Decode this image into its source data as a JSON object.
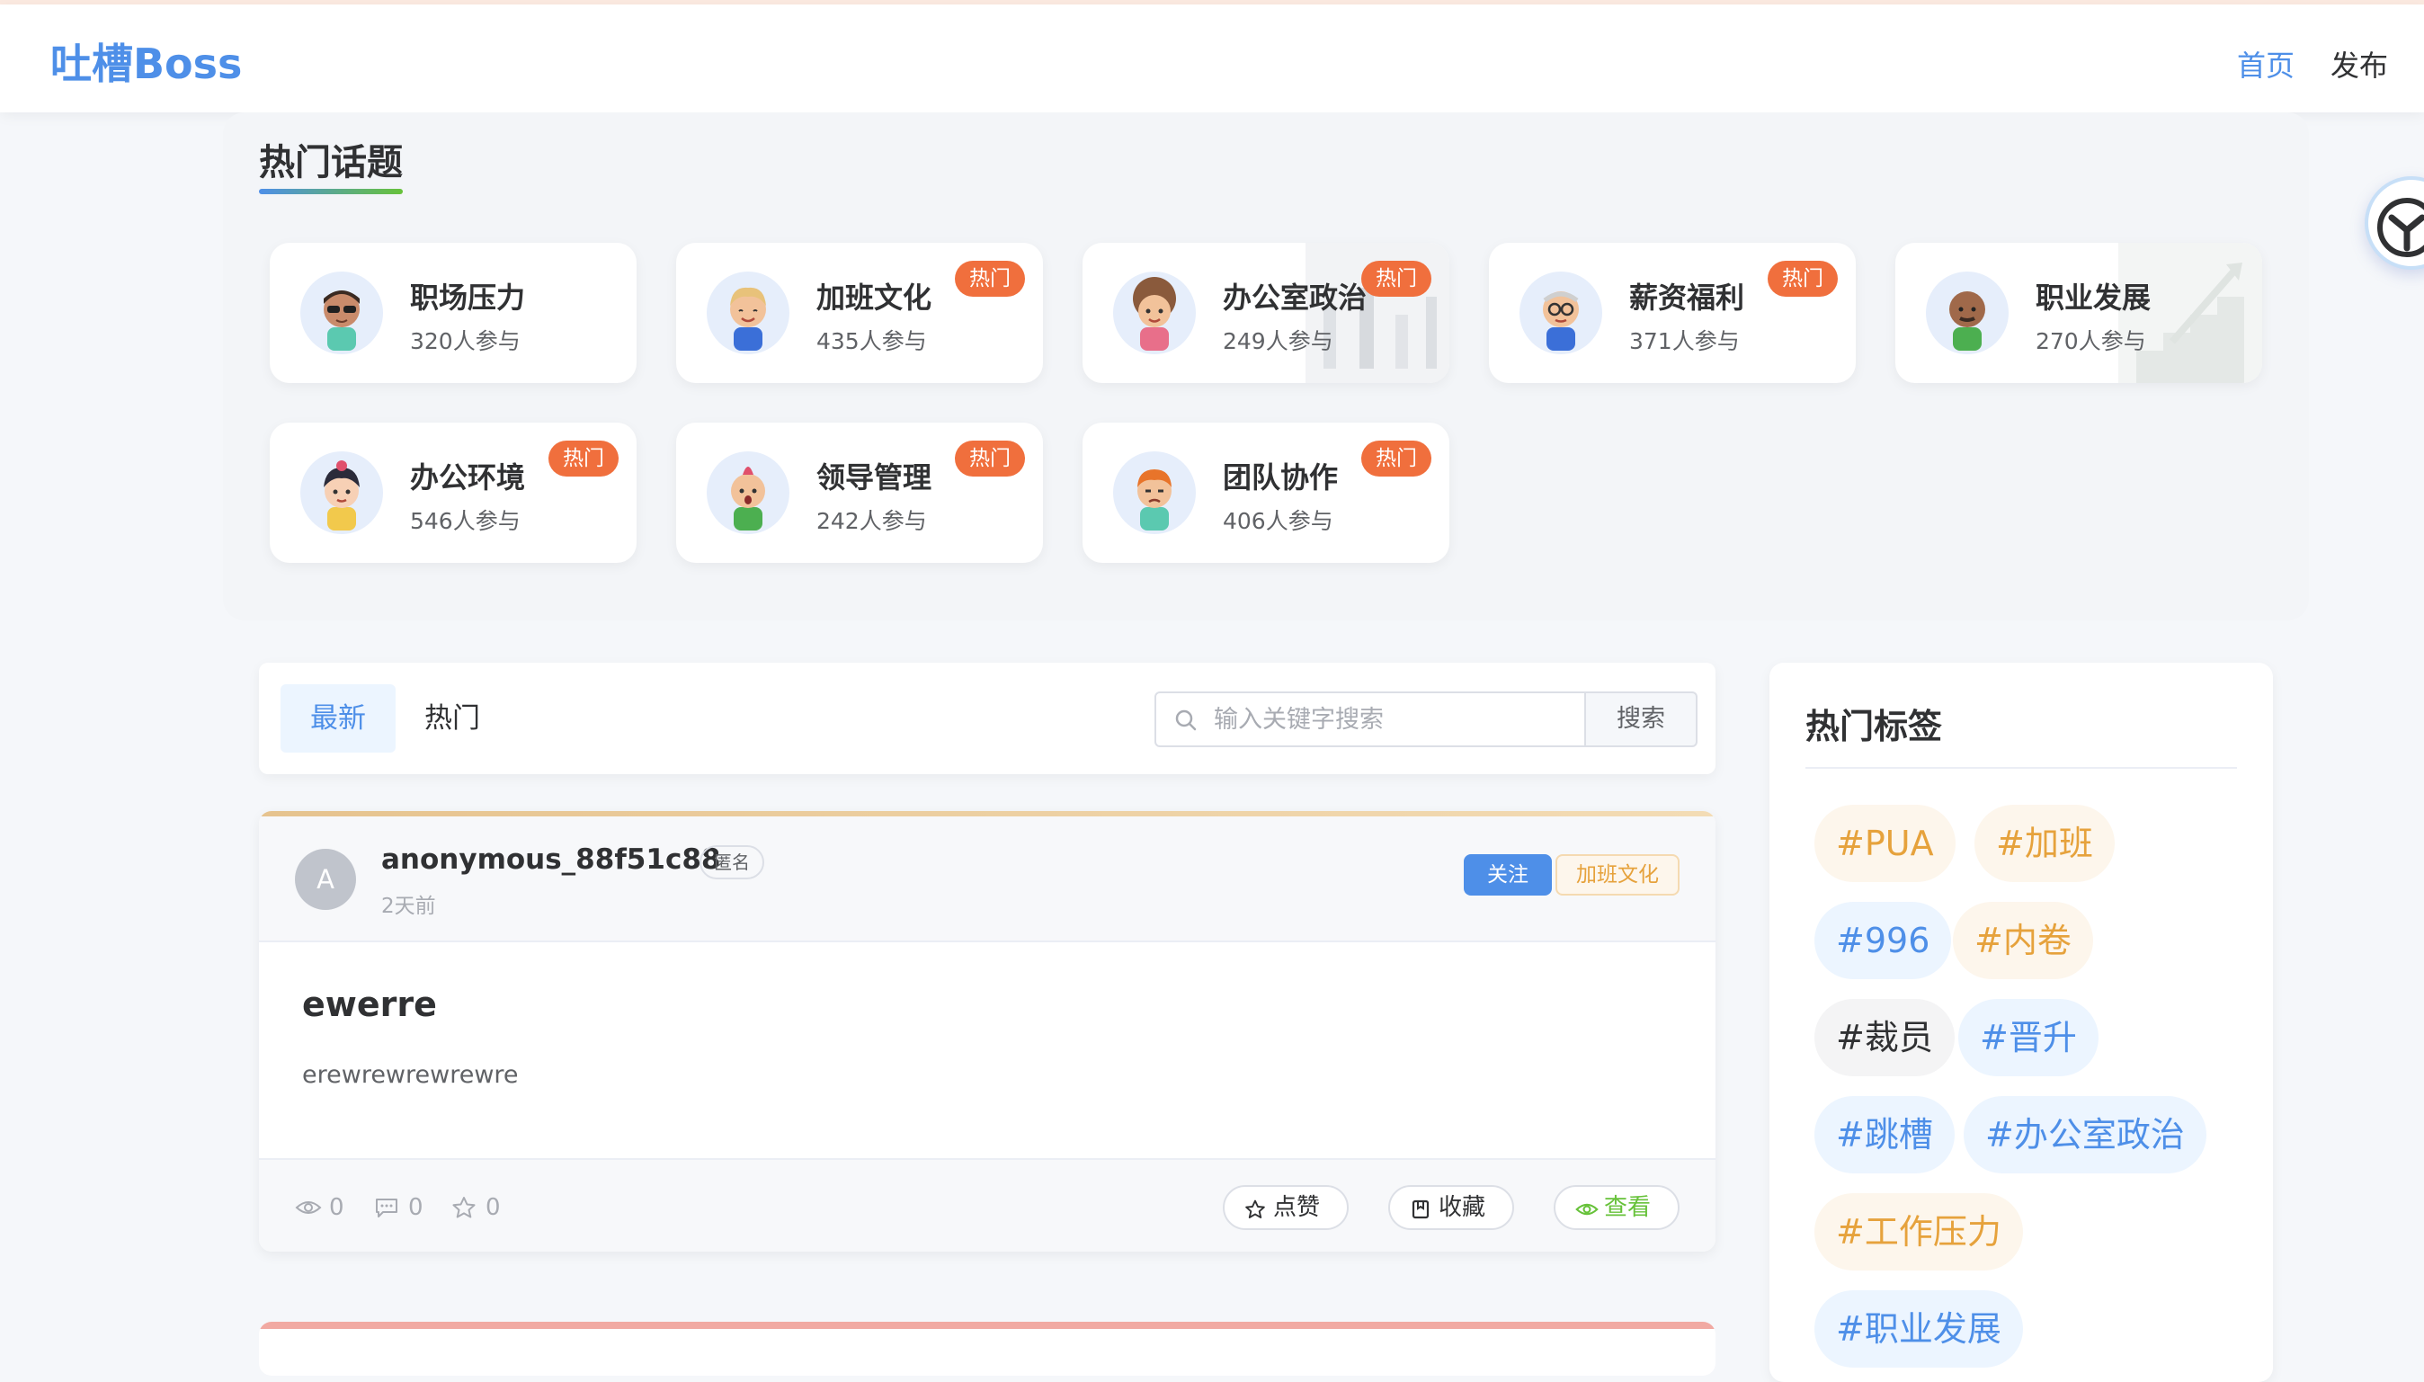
{
  "app": {
    "logo": "吐槽Boss",
    "nav": {
      "home": "首页",
      "publish": "发布"
    }
  },
  "colors": {
    "brand": "#4e8fe8",
    "hot_badge": "#f06f3d",
    "orange_tag": "#e6a23c",
    "green_action": "#67c23a"
  },
  "topics": {
    "title": "热门话题",
    "hot_label": "热门",
    "items": [
      {
        "name": "职场压力",
        "count": "320人参与",
        "hot": false,
        "icon": "avatar-sunglasses-icon"
      },
      {
        "name": "加班文化",
        "count": "435人参与",
        "hot": true,
        "icon": "avatar-blonde-icon"
      },
      {
        "name": "办公室政治",
        "count": "249人参与",
        "hot": true,
        "icon": "avatar-curly-hair-icon"
      },
      {
        "name": "薪资福利",
        "count": "371人参与",
        "hot": true,
        "icon": "avatar-glasses-icon"
      },
      {
        "name": "职业发展",
        "count": "270人参与",
        "hot": false,
        "icon": "avatar-bald-icon"
      },
      {
        "name": "办公环境",
        "count": "546人参与",
        "hot": true,
        "icon": "avatar-girl-icon"
      },
      {
        "name": "领导管理",
        "count": "242人参与",
        "hot": true,
        "icon": "avatar-mohawk-icon"
      },
      {
        "name": "团队协作",
        "count": "406人参与",
        "hot": true,
        "icon": "avatar-redhead-icon"
      }
    ]
  },
  "feed": {
    "tabs": {
      "latest": "最新",
      "hot": "热门"
    },
    "search": {
      "placeholder": "输入关键字搜索",
      "value": "",
      "button": "搜索"
    }
  },
  "post": {
    "avatar_letter": "A",
    "username": "anonymous_88f51c88",
    "anon_tag": "匿名",
    "time": "2天前",
    "follow": "关注",
    "category": "加班文化",
    "title": "ewerre",
    "body": "erewrewrewrewre",
    "stats": {
      "views": "0",
      "comments": "0",
      "stars": "0"
    },
    "actions": {
      "like": "点赞",
      "collect": "收藏",
      "view": "查看"
    }
  },
  "tags": {
    "title": "热门标签",
    "items": [
      {
        "label": "#PUA",
        "style": "orange"
      },
      {
        "label": "#加班",
        "style": "orange"
      },
      {
        "label": "#996",
        "style": "blue"
      },
      {
        "label": "#内卷",
        "style": "orange"
      },
      {
        "label": "#裁员",
        "style": "gray"
      },
      {
        "label": "#晋升",
        "style": "blue"
      },
      {
        "label": "#跳槽",
        "style": "blue"
      },
      {
        "label": "#办公室政治",
        "style": "blue"
      },
      {
        "label": "#工作压力",
        "style": "orange"
      },
      {
        "label": "#职业发展",
        "style": "blue"
      }
    ]
  }
}
